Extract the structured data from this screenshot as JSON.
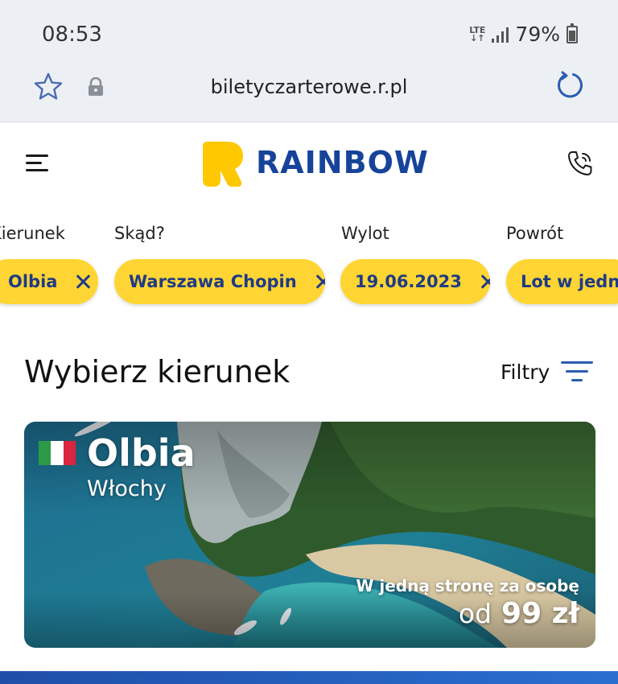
{
  "status_bar": {
    "time": "08:53",
    "network": "LTE",
    "battery": "79%"
  },
  "browser": {
    "url": "biletyczarterowe.r.pl",
    "icons": [
      "star-icon",
      "lock-icon",
      "reload-icon"
    ]
  },
  "header": {
    "brand": "RAINBOW",
    "brand_color": "#17449a",
    "logo_color": "#ffc800",
    "icons": [
      "menu-icon",
      "phone-icon"
    ]
  },
  "search": {
    "labels": {
      "destination": "Kierunek",
      "from": "Skąd?",
      "departure": "Wylot",
      "return": "Powrót"
    },
    "chips": {
      "destination": "Olbia",
      "from": "Warszawa Chopin",
      "departure": "19.06.2023",
      "return": "Lot w jedną"
    },
    "chip_color": "#ffd533"
  },
  "section": {
    "title": "Wybierz kierunek",
    "filters_label": "Filtry"
  },
  "destination_card": {
    "city": "Olbia",
    "country": "Włochy",
    "flag": [
      "#2c9b46",
      "#ffffff",
      "#d7263d"
    ],
    "price_note": "W jedną stronę za osobę",
    "price_prefix": "od",
    "price": "99 zł"
  }
}
